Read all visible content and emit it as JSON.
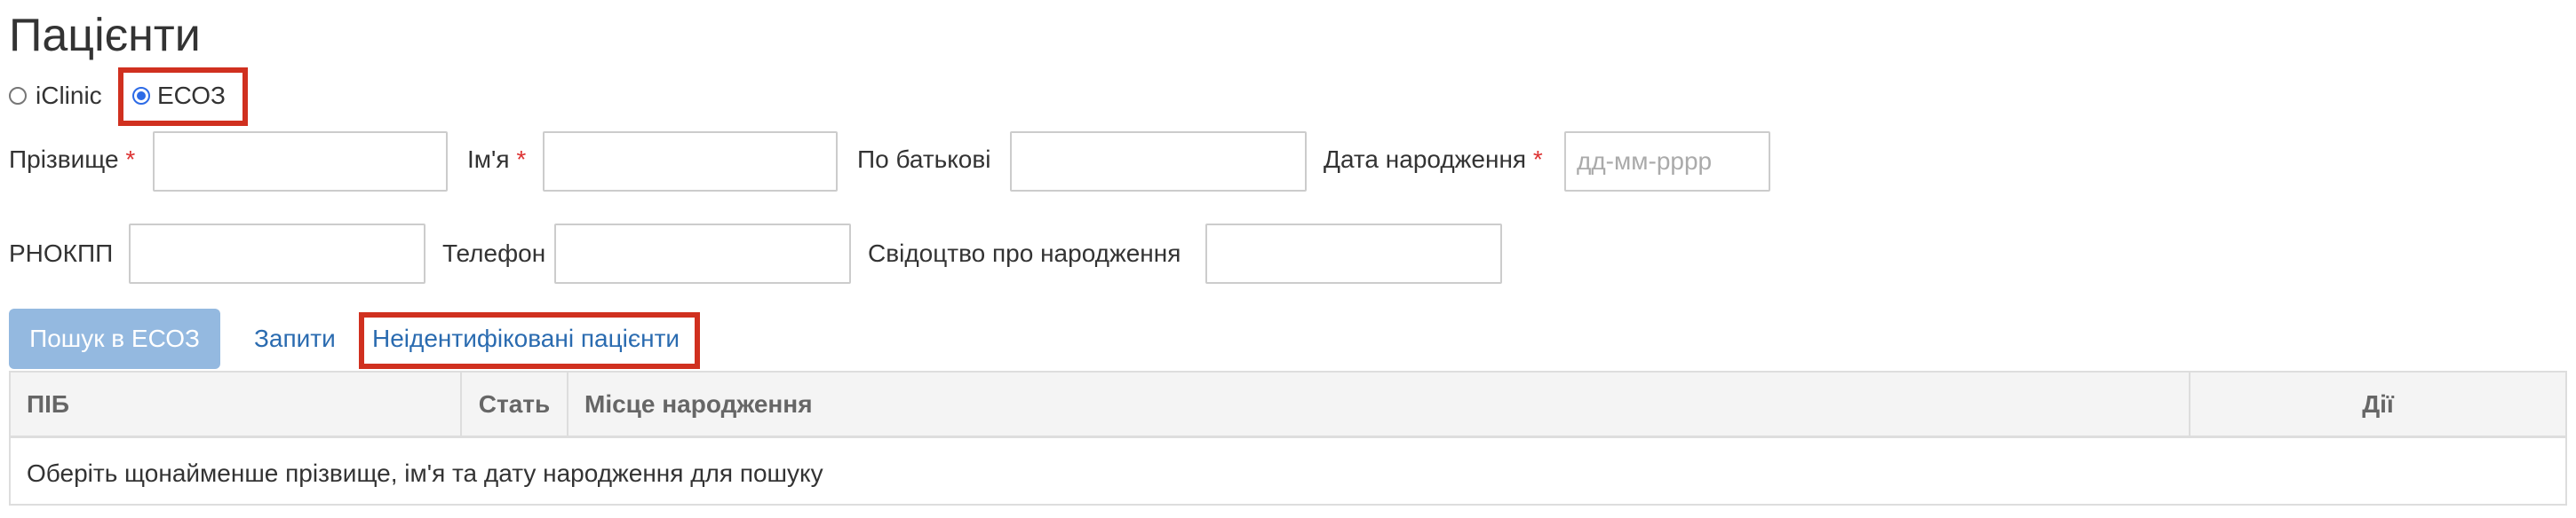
{
  "page": {
    "title": "Пацієнти"
  },
  "source": {
    "options": [
      {
        "label": "iClinic",
        "selected": false
      },
      {
        "label": "ЕСОЗ",
        "selected": true
      }
    ]
  },
  "form": {
    "last_name_label": "Прізвище",
    "first_name_label": "Ім'я",
    "patronymic_label": "По батькові",
    "birth_date_label": "Дата народження",
    "birth_date_placeholder": "дд-мм-рррр",
    "required_mark": "*",
    "tax_id_label": "РНОКПП",
    "phone_label": "Телефон",
    "birth_cert_label": "Свідоцтво про народження"
  },
  "actions": {
    "search_button": "Пошук в ЕСОЗ",
    "requests_link": "Запити",
    "unidentified_link": "Неідентифіковані пацієнти"
  },
  "table": {
    "headers": [
      "ПІБ",
      "Стать",
      "Місце народження",
      "Дії"
    ],
    "empty_message": "Оберіть щонайменше прізвище, ім'я та дату народження для пошуку"
  },
  "colors": {
    "highlight": "#d0301f",
    "primary_button": "#94b9e0",
    "link": "#2a6bb0"
  }
}
